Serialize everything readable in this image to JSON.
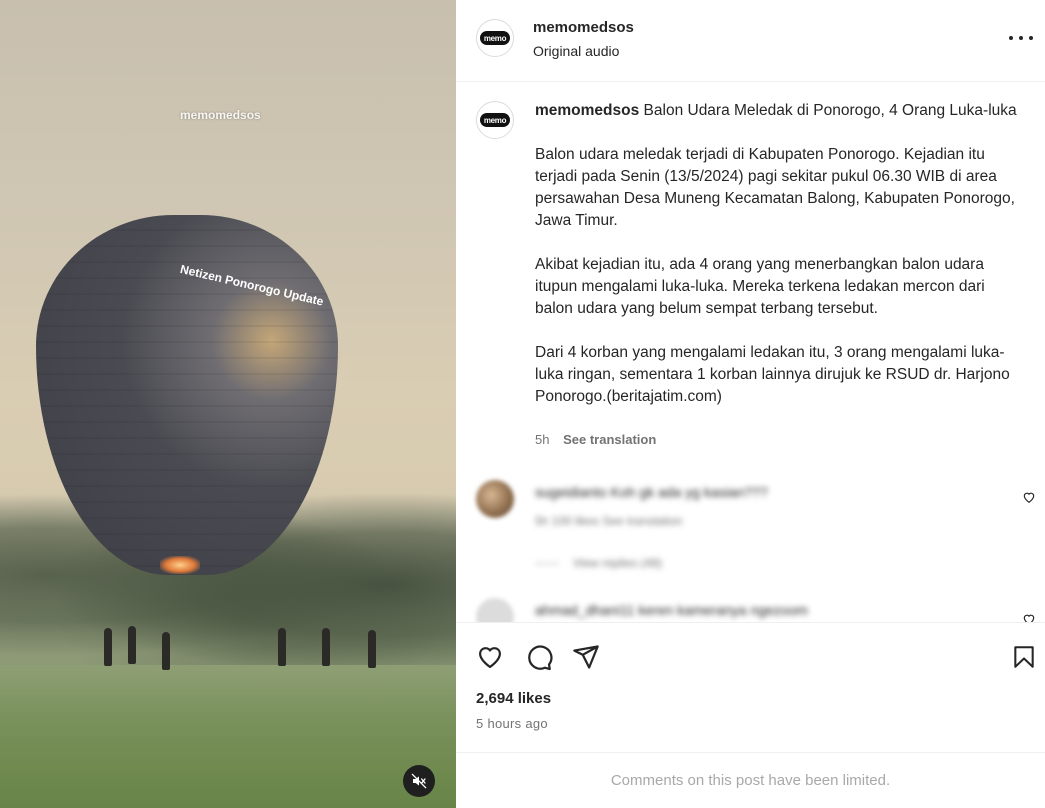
{
  "media": {
    "watermark": "memomedsos",
    "balloon_text": "Netizen Ponorogo Update",
    "mute_icon": "muted-speaker-icon"
  },
  "header": {
    "avatar_logo": "memo",
    "username": "memomedsos",
    "subtitle": "Original audio",
    "more_icon": "more-options-icon"
  },
  "caption": {
    "avatar_logo": "memo",
    "username": "memomedsos",
    "title": "Balon Udara Meledak di Ponorogo, 4 Orang Luka-luka",
    "paragraphs": [
      "Balon udara meledak terjadi di Kabupaten Ponorogo. Kejadian itu terjadi pada Senin (13/5/2024) pagi sekitar pukul 06.30 WIB di area persawahan Desa Muneng Kecamatan Balong, Kabupaten Ponorogo, Jawa Timur.",
      "Akibat kejadian itu, ada 4 orang yang menerbangkan balon udara itupun mengalami  luka-luka. Mereka terkena ledakan mercon dari balon udara yang belum sempat terbang tersebut.",
      "Dari 4 korban yang mengalami ledakan itu, 3 orang mengalami luka-luka ringan, sementara 1 korban lainnya dirujuk ke RSUD dr. Harjono Ponorogo.(beritajatim.com)"
    ],
    "age": "5h",
    "translate": "See translation"
  },
  "comments": [
    {
      "text": "sugeidianto Koh gk ada yg kasian???",
      "meta": "5h   100 likes   See translation",
      "replies": "View replies (48)"
    },
    {
      "text": "ahmad_dhani11 keren kameranya ngezoom"
    }
  ],
  "actions": {
    "like_icon": "heart-icon",
    "comment_icon": "comment-icon",
    "share_icon": "share-icon",
    "save_icon": "bookmark-icon",
    "likes": "2,694 likes",
    "time": "5 hours ago"
  },
  "footer": {
    "limited": "Comments on this post have been limited."
  },
  "colors": {
    "text": "#262626",
    "secondary": "#737373",
    "muted": "#a8a8a8",
    "border": "#efefef"
  }
}
